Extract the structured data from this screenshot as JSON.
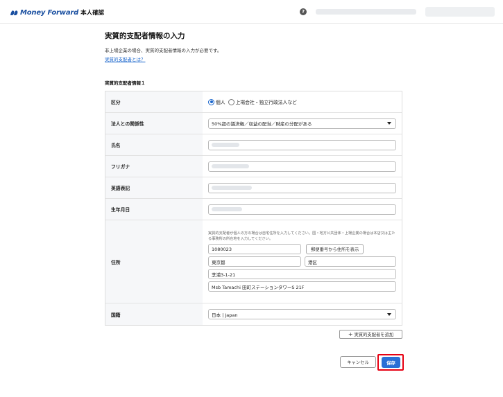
{
  "header": {
    "brand": "Money Forward",
    "service": "本人確認",
    "help_glyph": "?",
    "brand_color": "#1a4fa0"
  },
  "page": {
    "title": "実質的支配者情報の入力",
    "description": "非上場企業の場合、実質的支配者情報の入力が必要です。",
    "link": "実質的支配者とは？"
  },
  "section": {
    "title": "実質的支配者情報１"
  },
  "form": {
    "category": {
      "label": "区分",
      "options": [
        "個人",
        "上場会社・独立行政法人など"
      ],
      "selected": "個人"
    },
    "relation": {
      "label": "法人との関係性",
      "value": "50%超の議決権／収益の配当／財産の分配がある"
    },
    "name": {
      "label": "氏名"
    },
    "furigana": {
      "label": "フリガナ"
    },
    "english_name": {
      "label": "英語表記"
    },
    "birthdate": {
      "label": "生年月日"
    },
    "address": {
      "label": "住所",
      "note": "実質的支配者が個人の方の場合は自宅住所を入力してください。国・地方公共団体・上場企業の場合は本店又は主たる事務所の所在地を入力してください。",
      "postal_code": "1080023",
      "postal_lookup_button": "郵便番号から住所を表示",
      "prefecture": "東京都",
      "city": "港区",
      "street": "芝浦3-1-21",
      "building": "Msb Tamachi 田町ステーションタワーS 21F"
    },
    "nationality": {
      "label": "国籍",
      "value": "日本 | Japan"
    }
  },
  "actions": {
    "add_owner": "実質的支配者を追加",
    "add_icon": "+",
    "cancel": "キャンセル",
    "save": "保存",
    "save_color": "#2a6fd6",
    "highlight_color": "#e60012"
  }
}
